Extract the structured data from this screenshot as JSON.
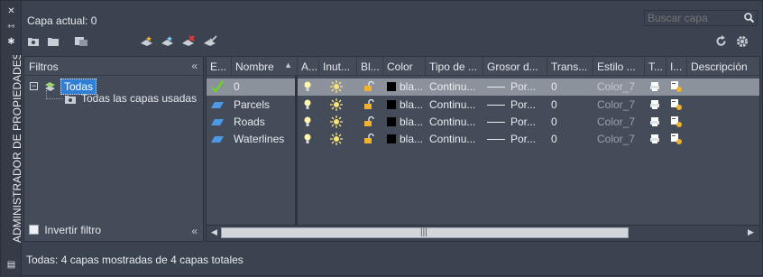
{
  "window": {
    "vertical_title": "ADMINISTRADOR DE PROPIEDADES DE...",
    "current_layer": "Capa actual: 0",
    "search_placeholder": "Buscar capa",
    "status": "Todas: 4 capas mostradas de 4 capas totales"
  },
  "filters": {
    "header": "Filtros",
    "tree_all": "Todas",
    "tree_used": "Todas las capas usadas",
    "invert_label": "Invertir filtro"
  },
  "columns": [
    "E...",
    "Nombre",
    "A...",
    "Inut...",
    "Bl...",
    "Color",
    "Tipo de ...",
    "Grosor d...",
    "Trans...",
    "Estilo ...",
    "T...",
    "I...",
    "Descripción"
  ],
  "layers": [
    {
      "name": "0",
      "color": "bla...",
      "linetype": "Continu...",
      "lineweight": "Por...",
      "transparency": "0",
      "plot_style": "Color_7",
      "current": true
    },
    {
      "name": "Parcels",
      "color": "bla...",
      "linetype": "Continu...",
      "lineweight": "Por...",
      "transparency": "0",
      "plot_style": "Color_7",
      "current": false
    },
    {
      "name": "Roads",
      "color": "bla...",
      "linetype": "Continu...",
      "lineweight": "Por...",
      "transparency": "0",
      "plot_style": "Color_7",
      "current": false
    },
    {
      "name": "Waterlines",
      "color": "bla...",
      "linetype": "Continu...",
      "lineweight": "Por...",
      "transparency": "0",
      "plot_style": "Color_7",
      "current": false
    }
  ],
  "colors": {
    "panel": "#444c5a",
    "background": "#3b4250",
    "selected_row": "#8c929b",
    "highlight": "#2f7fd6"
  }
}
